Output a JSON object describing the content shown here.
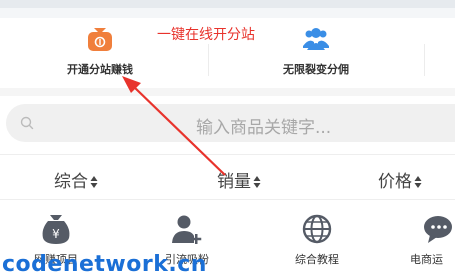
{
  "annotation": {
    "text": "一键在线开分站"
  },
  "features": [
    {
      "label": "开通分站赚钱",
      "icon": "moneybag-icon"
    },
    {
      "label": "无限裂变分佣",
      "icon": "users-icon"
    }
  ],
  "search": {
    "placeholder": "输入商品关键字..."
  },
  "sort": [
    {
      "label": "综合"
    },
    {
      "label": "销量"
    },
    {
      "label": "价格"
    }
  ],
  "categories": [
    {
      "label": "网赚项目",
      "icon": "moneybag-icon"
    },
    {
      "label": "引流吸粉",
      "icon": "add-user-icon"
    },
    {
      "label": "综合教程",
      "icon": "globe-icon"
    },
    {
      "label": "电商运",
      "icon": "chat-icon"
    }
  ],
  "watermark": "codenetwork.cn",
  "colors": {
    "annotation": "#e8332c",
    "watermark": "#1a6fd6",
    "icon_orange": "#f07f3c",
    "icon_blue": "#3a8ee6",
    "icon_gray": "#555b66"
  }
}
